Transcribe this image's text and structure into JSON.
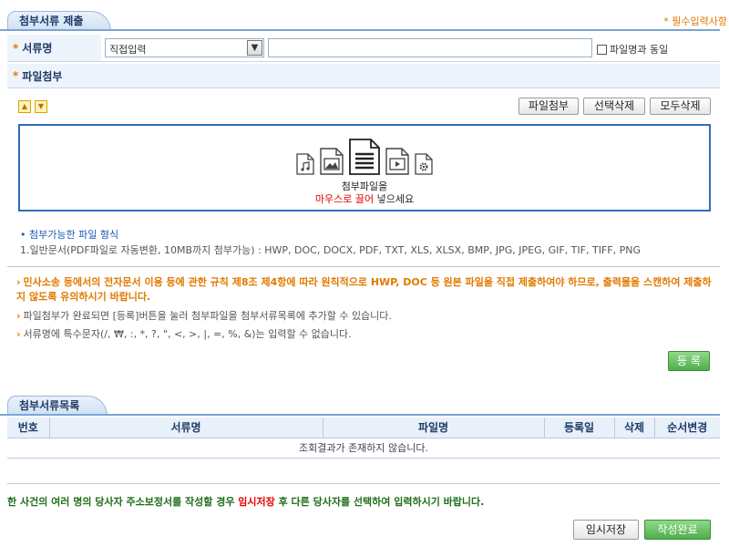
{
  "header": {
    "tab_label": "첨부서류 제출",
    "required_note": "* 필수입력사항"
  },
  "doc_name": {
    "label": "서류명",
    "select_value": "직접입력",
    "text_value": "",
    "same_as_file_label": "파일명과 동일"
  },
  "attach": {
    "label": "파일첨부"
  },
  "toolbar": {
    "attach_label": "파일첨부",
    "delete_selected_label": "선택삭제",
    "delete_all_label": "모두삭제"
  },
  "dropzone": {
    "line1": "첨부파일을",
    "drag_text": "마우스로 끌어",
    "drag_suffix": " 넣으세요"
  },
  "formats": {
    "title": "첨부가능한 파일 형식",
    "list": "1.일반문서(PDF파일로 자동변환, 10MB까지 첨부가능) : HWP, DOC, DOCX, PDF, TXT, XLS, XLSX, BMP, JPG, JPEG, GIF, TIF, TIFF, PNG"
  },
  "notices": {
    "bold": "민사소송 등에서의 전자문서 이용 등에 관한 규칙 제8조 제4항에 따라 원칙적으로 HWP, DOC 등 원본 파일을 직접 제출하여야 하므로, 출력물을 스캔하여 제출하지 않도록 유의하시기 바랍니다.",
    "n1": "파일첨부가 완료되면 [등록]버튼을 눌러 첨부파일을 첨부서류목록에 추가할 수 있습니다.",
    "n2": "서류명에 특수문자(/, ₩, :, *, ?, \", <, >, |, =, %, &)는 입력할 수 없습니다."
  },
  "register_label": "등 록",
  "list_section": {
    "tab_label": "첨부서류목록",
    "columns": [
      "번호",
      "서류명",
      "파일명",
      "등록일",
      "삭제",
      "순서변경"
    ],
    "empty_text": "조회결과가 존재하지 않습니다."
  },
  "bottom": {
    "notice_prefix": "한 사건의 여러 명의 당사자 주소보정서를 작성할 경우 ",
    "notice_highlight": "임시저장",
    "notice_suffix": " 후 다른 당사자를 선택하여 입력하시기 바랍니다.",
    "temp_save_label": "임시저장",
    "complete_label": "작성완료"
  }
}
